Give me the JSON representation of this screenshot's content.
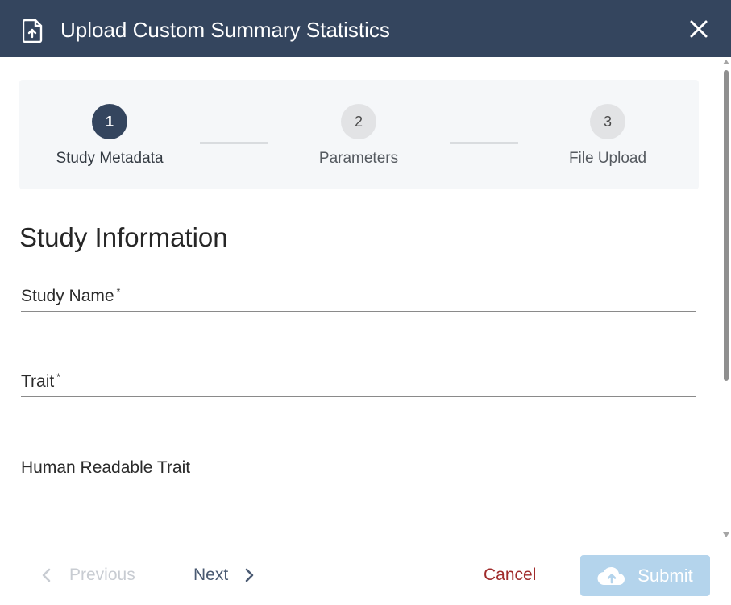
{
  "dialog": {
    "title": "Upload Custom Summary Statistics",
    "header_color": "#34455e"
  },
  "stepper": {
    "steps": [
      {
        "number": "1",
        "label": "Study Metadata",
        "active": true
      },
      {
        "number": "2",
        "label": "Parameters",
        "active": false
      },
      {
        "number": "3",
        "label": "File Upload",
        "active": false
      }
    ]
  },
  "form": {
    "section_title": "Study Information",
    "fields": [
      {
        "label": "Study Name",
        "required_mark": "*",
        "value": ""
      },
      {
        "label": "Trait",
        "required_mark": "*",
        "value": ""
      },
      {
        "label": "Human Readable Trait",
        "required_mark": "",
        "value": ""
      }
    ]
  },
  "footer": {
    "previous_label": "Previous",
    "next_label": "Next",
    "cancel_label": "Cancel",
    "submit_label": "Submit"
  },
  "icons": {
    "header_icon": "file-upload-icon",
    "close_icon": "close-icon",
    "previous_icon": "chevron-left-icon",
    "next_icon": "chevron-right-icon",
    "submit_icon": "cloud-upload-icon"
  },
  "colors": {
    "accent": "#34455e",
    "cancel": "#a02b2b",
    "submit_disabled": "#b4d4ec"
  }
}
